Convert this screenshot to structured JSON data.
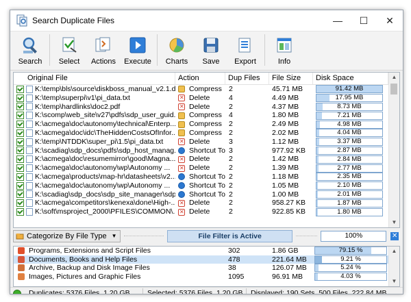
{
  "window": {
    "title": "Search Duplicate Files",
    "controls": {
      "minimize": "—",
      "maximize": "☐",
      "close": "✕"
    }
  },
  "toolbar": {
    "buttons": [
      {
        "label": "Search",
        "icon": "search-icon"
      },
      {
        "label": "Select",
        "icon": "select-icon"
      },
      {
        "label": "Actions",
        "icon": "actions-icon"
      },
      {
        "label": "Execute",
        "icon": "execute-icon"
      },
      {
        "label": "Charts",
        "icon": "charts-icon"
      },
      {
        "label": "Save",
        "icon": "save-icon"
      },
      {
        "label": "Export",
        "icon": "export-icon"
      },
      {
        "label": "Info",
        "icon": "info-icon"
      }
    ]
  },
  "files_table": {
    "columns": [
      "Original File",
      "Action",
      "Dup Files",
      "File Size",
      "Disk Space"
    ],
    "rows": [
      {
        "file": "K:\\temp\\bls\\source\\diskboss_manual_v2.1.d...",
        "action": "Compress",
        "action_type": "compress",
        "dup": "2",
        "size": "45.71 MB",
        "disk": "91.42 MB",
        "disk_pct": 100
      },
      {
        "file": "K:\\temp\\superpi\\v1\\pi_data.txt",
        "action": "Delete",
        "action_type": "delete",
        "dup": "4",
        "size": "4.49 MB",
        "disk": "17.95 MB",
        "disk_pct": 19.6
      },
      {
        "file": "K:\\temp\\hardlinks\\doc2.pdf",
        "action": "Delete",
        "action_type": "delete",
        "dup": "2",
        "size": "4.37 MB",
        "disk": "8.73 MB",
        "disk_pct": 9.5
      },
      {
        "file": "K:\\scomp\\web_site\\v27\\pdfs\\sdp_user_guid...",
        "action": "Compress",
        "action_type": "compress",
        "dup": "4",
        "size": "1.80 MB",
        "disk": "7.21 MB",
        "disk_pct": 7.9
      },
      {
        "file": "K:\\acmega\\doc\\autonomy\\technical\\Enterp...",
        "action": "Compress",
        "action_type": "compress",
        "dup": "2",
        "size": "2.49 MB",
        "disk": "4.98 MB",
        "disk_pct": 5.4
      },
      {
        "file": "K:\\acmega\\doc\\idc\\TheHiddenCostsOfInfor...",
        "action": "Compress",
        "action_type": "compress",
        "dup": "2",
        "size": "2.02 MB",
        "disk": "4.04 MB",
        "disk_pct": 4.4
      },
      {
        "file": "K:\\temp\\NTDDK\\super_pi\\1.5\\pi_data.txt",
        "action": "Delete",
        "action_type": "delete",
        "dup": "3",
        "size": "1.12 MB",
        "disk": "3.37 MB",
        "disk_pct": 3.7
      },
      {
        "file": "K:\\scadiag\\sdp_docs\\pdfs\\sdp_host_manag...",
        "action": "Shortcut To: ...",
        "action_type": "shortcut",
        "dup": "3",
        "size": "977.92 KB",
        "disk": "2.87 MB",
        "disk_pct": 3.1
      },
      {
        "file": "K:\\acmega\\doc\\resumemirror\\good\\Magna...",
        "action": "Delete",
        "action_type": "delete",
        "dup": "2",
        "size": "1.42 MB",
        "disk": "2.84 MB",
        "disk_pct": 3.1
      },
      {
        "file": "K:\\acmega\\doc\\autonomy\\wp\\Autonomy ...",
        "action": "Delete",
        "action_type": "delete",
        "dup": "2",
        "size": "1.39 MB",
        "disk": "2.77 MB",
        "disk_pct": 3.0
      },
      {
        "file": "K:\\acmega\\products\\map-hr\\datasheets\\v2...",
        "action": "Shortcut To: ...",
        "action_type": "shortcut",
        "dup": "2",
        "size": "1.18 MB",
        "disk": "2.35 MB",
        "disk_pct": 2.6
      },
      {
        "file": "K:\\acmega\\doc\\autonomy\\wp\\Autonomy ...",
        "action": "Shortcut To: ...",
        "action_type": "shortcut",
        "dup": "2",
        "size": "1.05 MB",
        "disk": "2.10 MB",
        "disk_pct": 2.3
      },
      {
        "file": "K:\\scadiag\\sdp_docs\\sdp_site_manager\\sdp...",
        "action": "Shortcut To: ...",
        "action_type": "shortcut",
        "dup": "2",
        "size": "1.00 MB",
        "disk": "2.01 MB",
        "disk_pct": 2.2
      },
      {
        "file": "K:\\acmega\\competitors\\kenexa\\done\\High-...",
        "action": "Delete",
        "action_type": "delete",
        "dup": "2",
        "size": "958.27 KB",
        "disk": "1.87 MB",
        "disk_pct": 2.0
      },
      {
        "file": "K:\\soft\\msproject_2000\\PFILES\\COMMON\\...",
        "action": "Delete",
        "action_type": "delete",
        "dup": "2",
        "size": "922.85 KB",
        "disk": "1.80 MB",
        "disk_pct": 2.0
      }
    ]
  },
  "filter_bar": {
    "category_select": "Categorize By File Type",
    "filter_status": "File Filter is Active",
    "percent": "100%",
    "close": "✕"
  },
  "categories": [
    {
      "name": "Programs, Extensions and Script Files",
      "files": "302",
      "size": "1.86 GB",
      "pct": "79.15 %",
      "pct_value": 79.15,
      "color": "#e0502c",
      "selected": false
    },
    {
      "name": "Documents, Books and Help Files",
      "files": "478",
      "size": "221.64 MB",
      "pct": "9.21 %",
      "pct_value": 9.21,
      "color": "#d8563a",
      "selected": true
    },
    {
      "name": "Archive, Backup and Disk Image Files",
      "files": "38",
      "size": "126.07 MB",
      "pct": "5.24 %",
      "pct_value": 5.24,
      "color": "#d0703a",
      "selected": false
    },
    {
      "name": "Images, Pictures and Graphic Files",
      "files": "1095",
      "size": "96.91 MB",
      "pct": "4.03 %",
      "pct_value": 4.03,
      "color": "#e08040",
      "selected": false
    }
  ],
  "status": {
    "duplicates": "Duplicates: 5376 Files, 1.20 GB",
    "selected": "Selected: 5376 Files, 1.20 GB",
    "displayed": "Displayed: 190 Sets, 500 Files, 222.84 MB"
  }
}
